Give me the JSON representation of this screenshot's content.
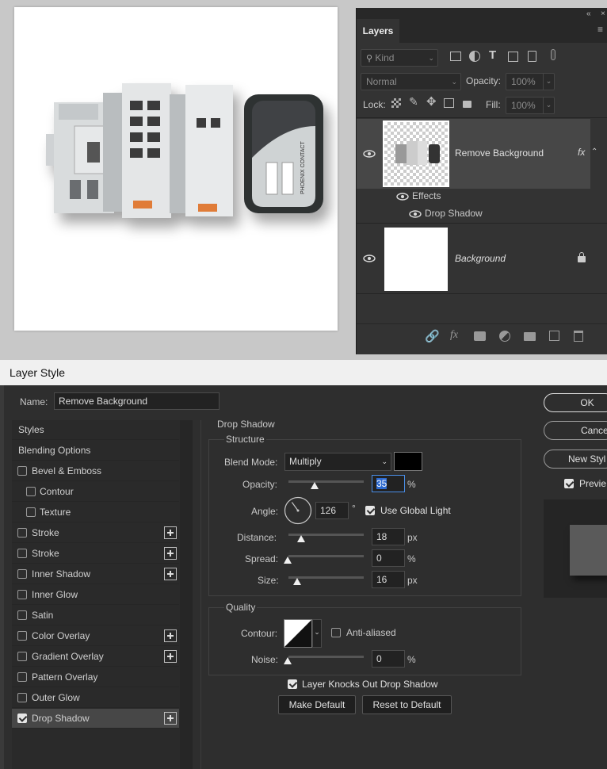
{
  "layers_panel": {
    "tab_label": "Layers",
    "filter_kind": "Kind",
    "blend_mode": "Normal",
    "opacity_label": "Opacity:",
    "opacity_value": "100%",
    "lock_label": "Lock:",
    "fill_label": "Fill:",
    "fill_value": "100%",
    "layers": [
      {
        "name": "Remove Background",
        "fx": "fx",
        "effects_label": "Effects",
        "effect": "Drop Shadow"
      },
      {
        "name": "Background"
      }
    ]
  },
  "canvas": {
    "device_labels": [
      "PHOENIX CONTACT"
    ]
  },
  "dialog": {
    "title": "Layer Style",
    "name_label": "Name:",
    "name_value": "Remove Background",
    "buttons": {
      "ok": "OK",
      "cancel": "Cance",
      "new_style": "New Styl",
      "preview": "Previe"
    },
    "styles": [
      {
        "label": "Styles",
        "checkbox": false,
        "plus": false,
        "indent": false
      },
      {
        "label": "Blending Options",
        "checkbox": false,
        "plus": false,
        "indent": false
      },
      {
        "label": "Bevel & Emboss",
        "checkbox": true,
        "checked": false,
        "plus": false,
        "indent": false
      },
      {
        "label": "Contour",
        "checkbox": true,
        "checked": false,
        "plus": false,
        "indent": true
      },
      {
        "label": "Texture",
        "checkbox": true,
        "checked": false,
        "plus": false,
        "indent": true
      },
      {
        "label": "Stroke",
        "checkbox": true,
        "checked": false,
        "plus": true,
        "indent": false
      },
      {
        "label": "Stroke",
        "checkbox": true,
        "checked": false,
        "plus": true,
        "indent": false
      },
      {
        "label": "Inner Shadow",
        "checkbox": true,
        "checked": false,
        "plus": true,
        "indent": false
      },
      {
        "label": "Inner Glow",
        "checkbox": true,
        "checked": false,
        "plus": false,
        "indent": false
      },
      {
        "label": "Satin",
        "checkbox": true,
        "checked": false,
        "plus": false,
        "indent": false
      },
      {
        "label": "Color Overlay",
        "checkbox": true,
        "checked": false,
        "plus": true,
        "indent": false
      },
      {
        "label": "Gradient Overlay",
        "checkbox": true,
        "checked": false,
        "plus": true,
        "indent": false
      },
      {
        "label": "Pattern Overlay",
        "checkbox": true,
        "checked": false,
        "plus": false,
        "indent": false
      },
      {
        "label": "Outer Glow",
        "checkbox": true,
        "checked": false,
        "plus": false,
        "indent": false
      },
      {
        "label": "Drop Shadow",
        "checkbox": true,
        "checked": true,
        "plus": true,
        "indent": false,
        "selected": true
      }
    ],
    "drop_shadow": {
      "section_title": "Drop Shadow",
      "structure_title": "Structure",
      "blend_mode_label": "Blend Mode:",
      "blend_mode_value": "Multiply",
      "shadow_color": "#000000",
      "opacity_label": "Opacity:",
      "opacity_value": "35",
      "opacity_unit": "%",
      "opacity_level": 0.35,
      "angle_label": "Angle:",
      "angle_value": "126",
      "angle_unit": "°",
      "use_global_light": "Use Global Light",
      "distance_label": "Distance:",
      "distance_value": "18",
      "distance_unit": "px",
      "spread_label": "Spread:",
      "spread_value": "0",
      "spread_unit": "%",
      "size_label": "Size:",
      "size_value": "16",
      "size_unit": "px",
      "quality_title": "Quality",
      "contour_label": "Contour:",
      "anti_aliased": "Anti-aliased",
      "noise_label": "Noise:",
      "noise_value": "0",
      "noise_unit": "%",
      "knocks_out": "Layer Knocks Out Drop Shadow",
      "make_default": "Make Default",
      "reset_default": "Reset to Default"
    }
  }
}
